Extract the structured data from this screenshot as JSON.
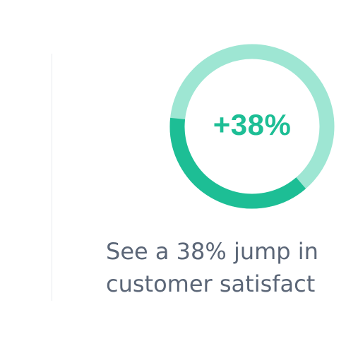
{
  "stat": {
    "value_text": "+38%",
    "percent": 38,
    "colors": {
      "track": "#9ee6d3",
      "fill": "#1dbe95",
      "text": "#1dbe95"
    }
  },
  "caption": {
    "line1": "See a 38% jump in",
    "line2": "customer satisfact"
  }
}
